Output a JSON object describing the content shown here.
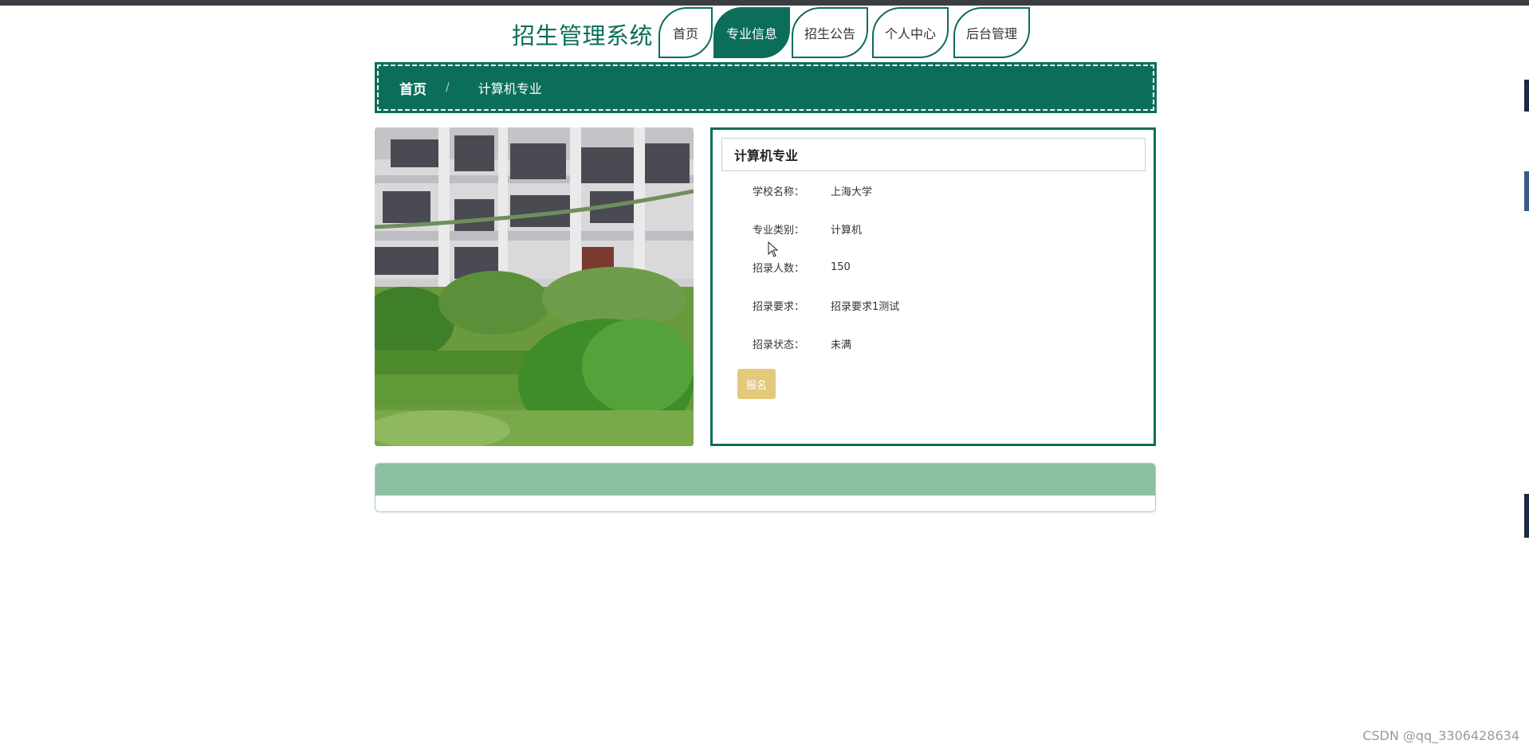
{
  "site": {
    "title": "招生管理系统"
  },
  "nav": {
    "items": [
      {
        "label": "首页",
        "active": false
      },
      {
        "label": "专业信息",
        "active": true
      },
      {
        "label": "招生公告",
        "active": false
      },
      {
        "label": "个人中心",
        "active": false
      },
      {
        "label": "后台管理",
        "active": false
      }
    ]
  },
  "breadcrumb": {
    "home": "首页",
    "separator": "/",
    "current": "计算机专业"
  },
  "detail": {
    "title": "计算机专业",
    "fields": [
      {
        "label": "学校名称：",
        "value": "上海大学"
      },
      {
        "label": "专业类别：",
        "value": "计算机"
      },
      {
        "label": "招录人数：",
        "value": "150"
      },
      {
        "label": "招录要求：",
        "value": "招录要求1测试"
      },
      {
        "label": "招录状态：",
        "value": "未满"
      }
    ],
    "signup_label": "报名"
  },
  "watermark": "CSDN @qq_3306428634",
  "colors": {
    "primary": "#0b6e5a",
    "button": "#e5c97a",
    "comments_header": "#8dbfa3"
  }
}
